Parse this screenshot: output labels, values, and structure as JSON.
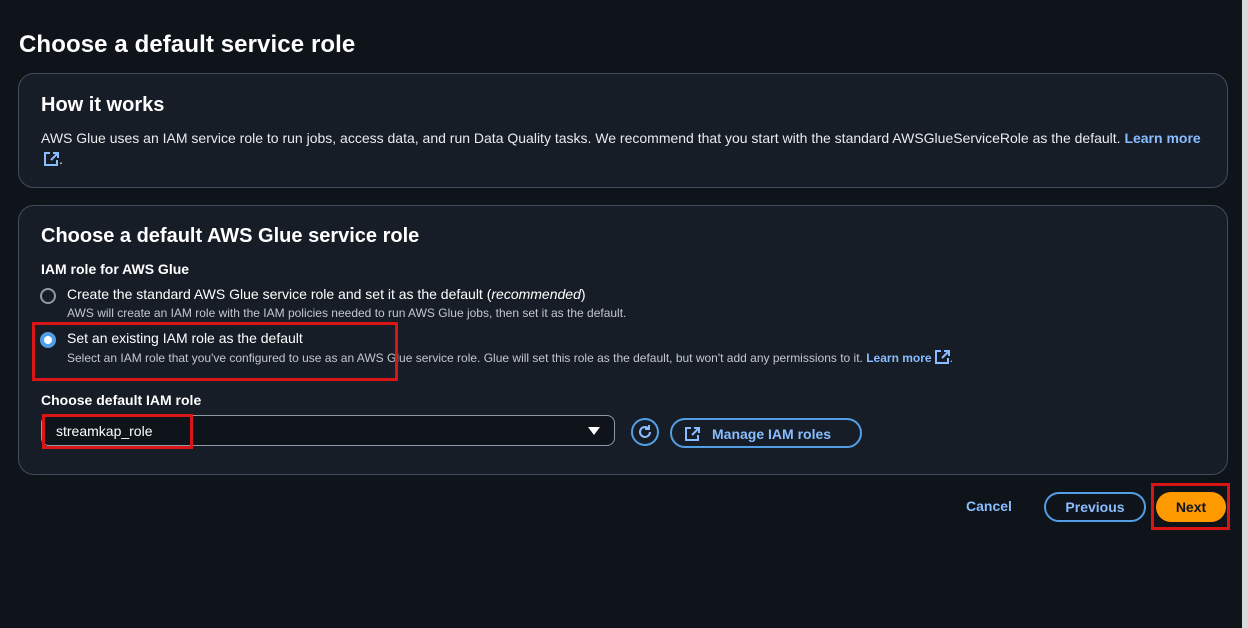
{
  "page": {
    "title": "Choose a default service role"
  },
  "how_it_works": {
    "heading": "How it works",
    "text": "AWS Glue uses an IAM service role to run jobs, access data, and run Data Quality tasks. We recommend that you start with the standard AWSGlueServiceRole as the default.",
    "learn_more": "Learn more"
  },
  "role_panel": {
    "heading": "Choose a default AWS Glue service role",
    "iam_label": "IAM role for AWS Glue",
    "options": [
      {
        "label_main": "Create the standard AWS Glue service role and set it as the default (",
        "label_emph": "recommended",
        "label_end": ")",
        "description": "AWS will create an IAM role with the IAM policies needed to run AWS Glue jobs, then set it as the default.",
        "selected": false
      },
      {
        "label_main": "Set an existing IAM role as the default",
        "description": "Select an IAM role that you've configured to use as an AWS Glue service role. Glue will set this role as the default, but won't add any permissions to it.",
        "learn_more": "Learn more",
        "selected": true
      }
    ],
    "default_role_label": "Choose default IAM role",
    "selected_role": "streamkap_role",
    "manage_label": "Manage IAM roles"
  },
  "footer": {
    "cancel": "Cancel",
    "previous": "Previous",
    "next": "Next"
  },
  "colors": {
    "background": "#0f141a",
    "link": "#89bdff",
    "primary": "#ff9900",
    "annotation": "#d91515"
  },
  "icons": [
    "external-link-icon",
    "refresh-icon",
    "chevron-down-icon"
  ]
}
